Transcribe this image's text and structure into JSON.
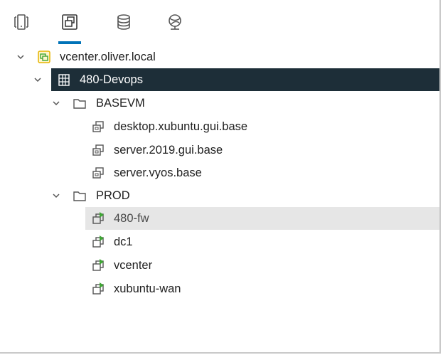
{
  "toolbar": {
    "tabs": [
      {
        "id": "hosts-clusters",
        "icon": "hosts-clusters-icon"
      },
      {
        "id": "vms-templates",
        "icon": "vms-templates-icon",
        "active": true
      },
      {
        "id": "storage",
        "icon": "storage-icon"
      },
      {
        "id": "networking",
        "icon": "networking-icon"
      }
    ]
  },
  "tree": {
    "vcenter": {
      "label": "vcenter.oliver.local",
      "expanded": true
    },
    "datacenter": {
      "label": "480-Devops",
      "expanded": true,
      "selected": true
    },
    "folders": [
      {
        "label": "BASEVM",
        "expanded": true,
        "items": [
          {
            "label": "desktop.xubuntu.gui.base",
            "type": "template"
          },
          {
            "label": "server.2019.gui.base",
            "type": "template"
          },
          {
            "label": "server.vyos.base",
            "type": "template"
          }
        ]
      },
      {
        "label": "PROD",
        "expanded": true,
        "items": [
          {
            "label": "480-fw",
            "type": "vm-powered-on",
            "hovered": true
          },
          {
            "label": "dc1",
            "type": "vm-powered-on"
          },
          {
            "label": "vcenter",
            "type": "vm-powered-on"
          },
          {
            "label": "xubuntu-wan",
            "type": "vm-powered-on"
          }
        ]
      }
    ]
  },
  "colors": {
    "selected_bg": "#1d2e38",
    "hover_bg": "#e6e6e6",
    "tab_active": "#0073b8",
    "power_on": "#3fa535",
    "vcenter_icon": "#e6b400"
  }
}
